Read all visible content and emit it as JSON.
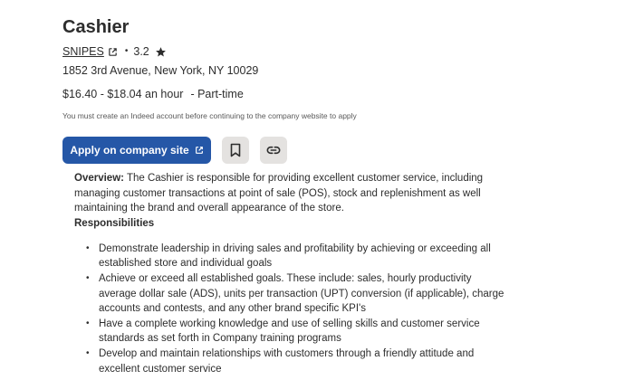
{
  "job": {
    "title": "Cashier",
    "company": "SNIPES",
    "rating": "3.2",
    "rating_separator": "•",
    "address": "1852 3rd Avenue, New York, NY 10029",
    "pay": "$16.40 - $18.04 an hour",
    "job_type": "- Part-time",
    "account_notice": "You must create an Indeed account before continuing to the company website to apply"
  },
  "actions": {
    "apply_label": "Apply on company site",
    "apply_icon": "external-link-icon",
    "save_icon": "bookmark-icon",
    "copy_link_icon": "link-icon"
  },
  "description": {
    "overview_label": "Overview:",
    "overview_text": " The Cashier is responsible for providing excellent customer service, including managing customer transactions at point of sale (POS), stock and replenishment as well maintaining the brand and overall appearance of the store.",
    "responsibilities_heading": "Responsibilities",
    "responsibilities": [
      "Demonstrate leadership in driving sales and profitability by achieving or exceeding all established store and individual goals",
      "Achieve or exceed all established goals. These include: sales, hourly productivity average dollar sale (ADS), units per transaction (UPT) conversion (if applicable), charge accounts and contests, and any other brand specific KPI's",
      "Have a complete working knowledge and use of selling skills and customer service standards as set forth in Company training programs",
      "Develop and maintain relationships with customers through a friendly attitude and excellent customer service"
    ]
  },
  "colors": {
    "primary_button": "#2557a7",
    "secondary_button": "#e4e2e0",
    "text": "#2d2d2d"
  }
}
